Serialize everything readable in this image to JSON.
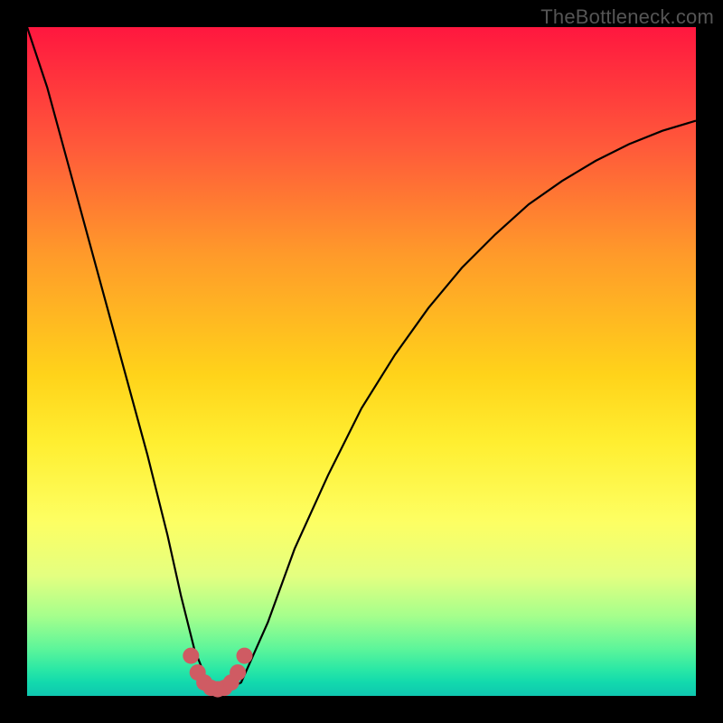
{
  "watermark": "TheBottleneck.com",
  "colors": {
    "frame": "#000000",
    "curve": "#000000",
    "marker": "#cf5b63"
  },
  "chart_data": {
    "type": "line",
    "title": "",
    "xlabel": "",
    "ylabel": "",
    "xlim": [
      0,
      100
    ],
    "ylim": [
      0,
      100
    ],
    "grid": false,
    "series": [
      {
        "name": "bottleneck-curve",
        "x": [
          0,
          3,
          6,
          9,
          12,
          15,
          18,
          21,
          23,
          25,
          27,
          29,
          30,
          32,
          36,
          40,
          45,
          50,
          55,
          60,
          65,
          70,
          75,
          80,
          85,
          90,
          95,
          100
        ],
        "y": [
          100,
          91,
          80,
          69,
          58,
          47,
          36,
          24,
          15,
          7,
          2,
          1,
          1,
          2,
          11,
          22,
          33,
          43,
          51,
          58,
          64,
          69,
          73.5,
          77,
          80,
          82.5,
          84.5,
          86
        ]
      },
      {
        "name": "optimal-region-markers",
        "x": [
          24.5,
          25.5,
          26.5,
          27.5,
          28.5,
          29.5,
          30.5,
          31.5,
          32.5
        ],
        "y": [
          6,
          3.5,
          2,
          1.2,
          1,
          1.2,
          2,
          3.5,
          6
        ]
      }
    ]
  }
}
